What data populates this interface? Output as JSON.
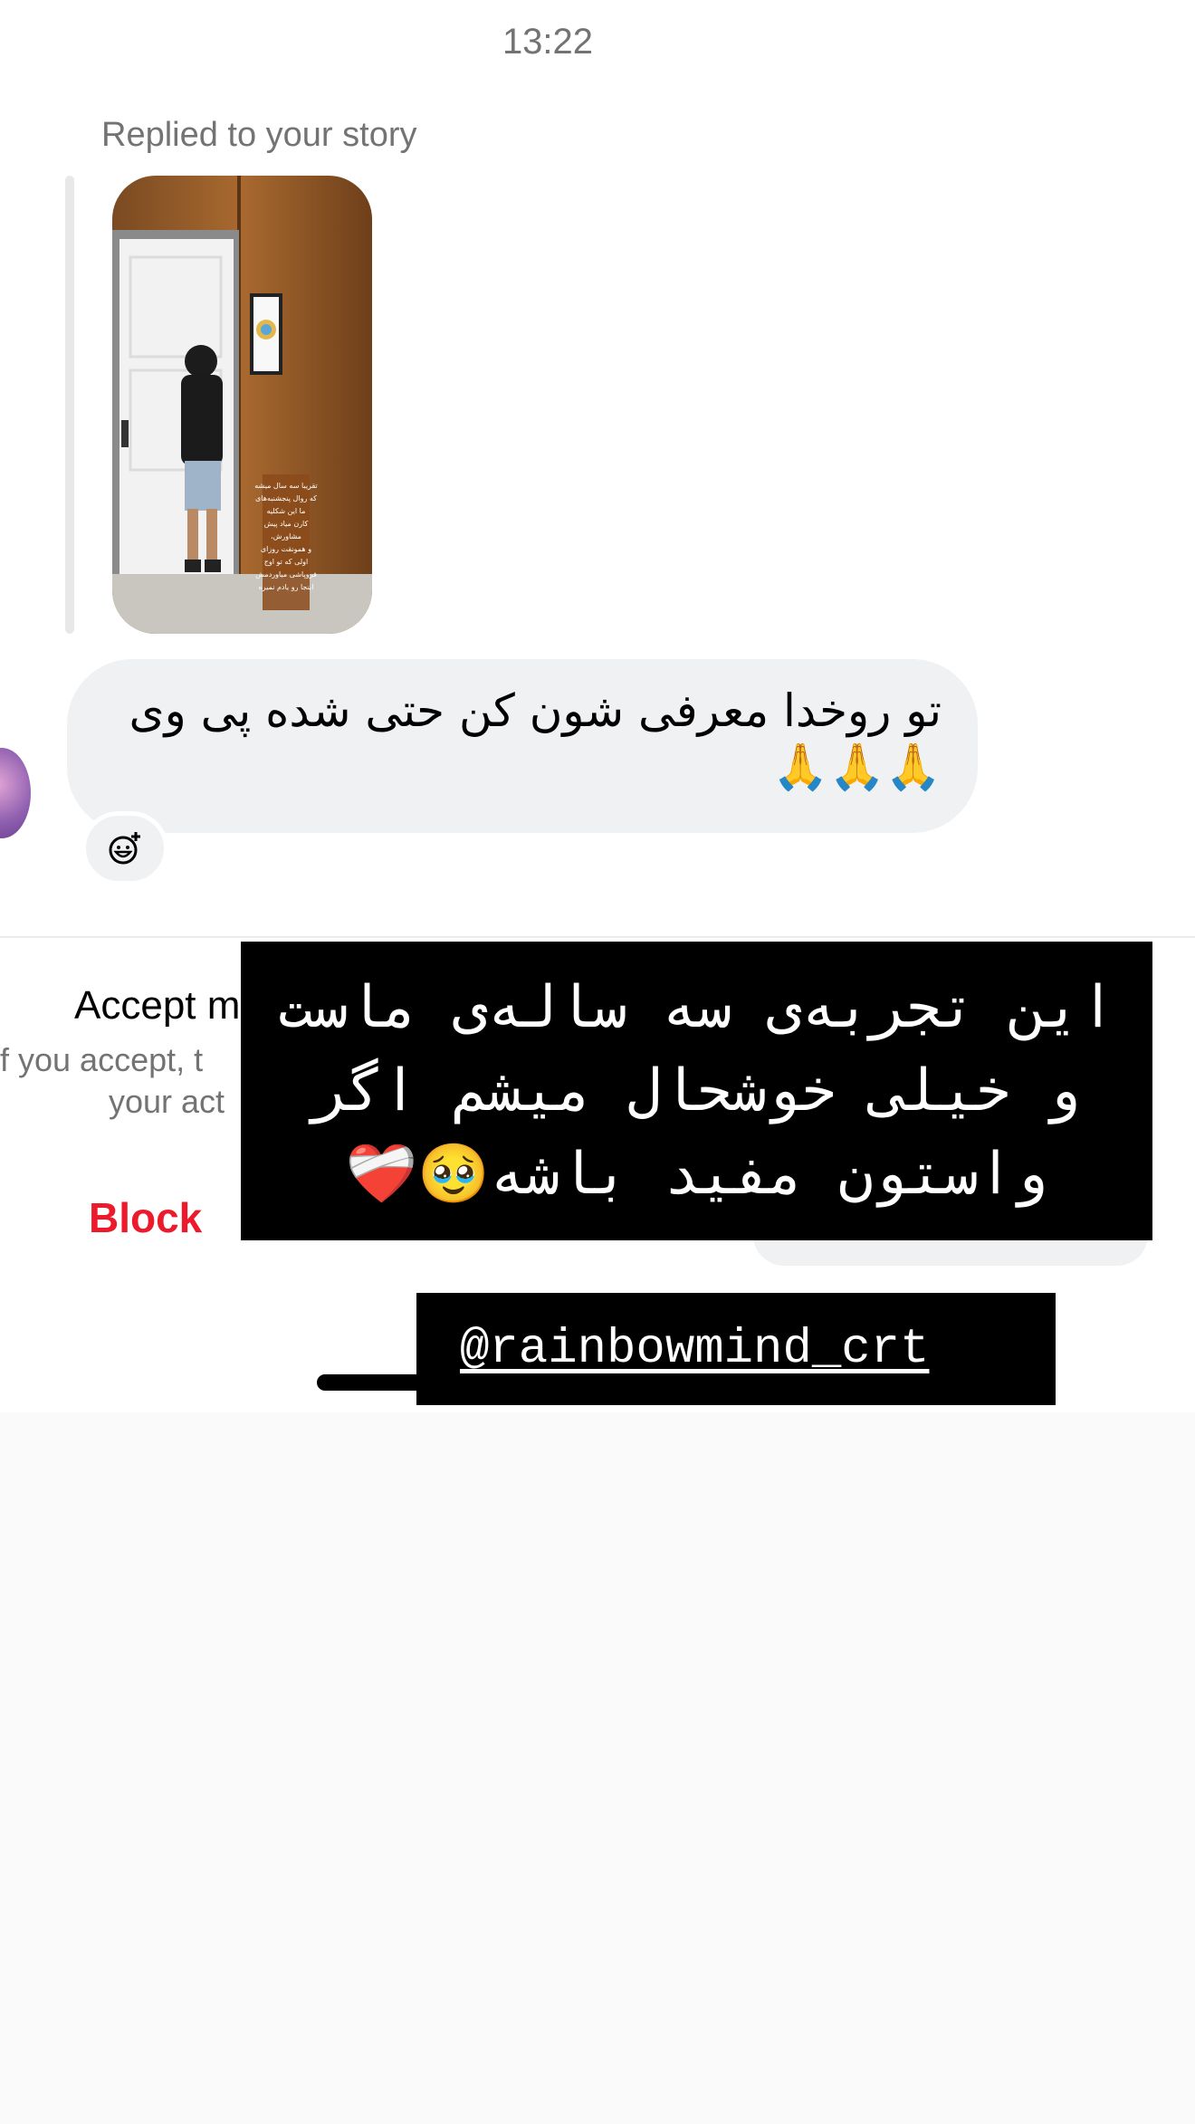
{
  "timestamp": "13:22",
  "story_reply": {
    "label": "Replied to your story",
    "thumbnail_text": [
      "تقریبا سه سال میشه",
      "که روال پنجشنبه‌های",
      "ما این شکلیه",
      "کارن میاد پیش",
      "مشاورش،",
      "و همونقت روزای",
      "اولی که تو اوج",
      "فروپاشی میاوردمش",
      "اینجا رو یادم نمیره"
    ]
  },
  "message": {
    "text": "تو روخدا معرفی شون کن حتی شده پی وی 🙏🙏🙏"
  },
  "request_panel": {
    "accept_title": "Accept m",
    "accept_desc_line1": "f you accept, t",
    "accept_desc_line2": "your act",
    "block_label": "Block"
  },
  "overlay": {
    "caption": "این تجربه‌ی سه ساله‌ی ماست\nو خیلی خوشحال میشم اگر\nواستون مفید باشه🥹❤️‍🩹",
    "mention": "@rainbowmind_crt"
  },
  "icons": {
    "react": "add-reaction-icon"
  },
  "colors": {
    "bubble": "#f0f1f3",
    "block": "#ed1a2c",
    "muted_text": "#737373",
    "overlay_bg": "#000000"
  }
}
